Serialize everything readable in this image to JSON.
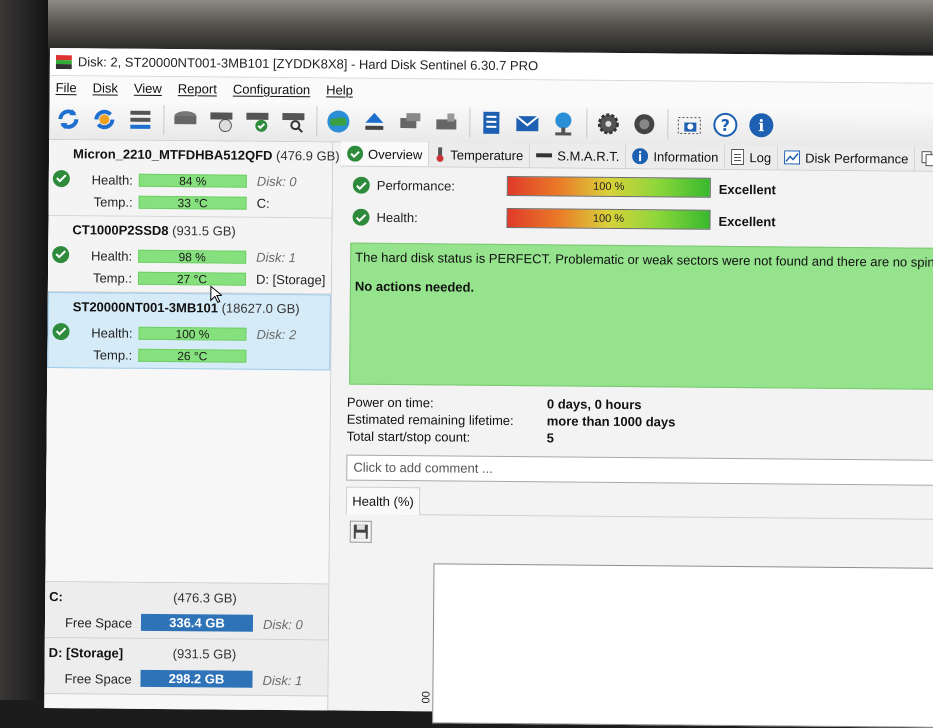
{
  "window": {
    "title": "Disk: 2, ST20000NT001-3MB101 [ZYDDK8X8]  -  Hard Disk Sentinel 6.30.7 PRO"
  },
  "menu": [
    "File",
    "Disk",
    "View",
    "Report",
    "Configuration",
    "Help"
  ],
  "toolbar": {
    "icons": [
      "refresh-icon",
      "refresh-settings-icon",
      "disk-list-icon",
      "disk-icon",
      "disk-schedule-icon",
      "disk-check-icon",
      "disk-search-icon",
      "globe-icon",
      "eject-icon",
      "network-disk-icon",
      "disk-lock-icon",
      "notes-icon",
      "mail-icon",
      "network-icon",
      "gear-icon",
      "speaker-icon",
      "camera-icon",
      "help-icon",
      "info-icon"
    ]
  },
  "disks": [
    {
      "model": "Micron_2210_MTFDHBA512QFD",
      "size": "(476.9 GB)",
      "health_label": "Health:",
      "health": "84 %",
      "temp_label": "Temp.:",
      "temp": "33 °C",
      "disk_ref": "Disk: 0",
      "drive": "C:"
    },
    {
      "model": "CT1000P2SSD8",
      "size": "(931.5 GB)",
      "health_label": "Health:",
      "health": "98 %",
      "temp_label": "Temp.:",
      "temp": "27 °C",
      "disk_ref": "Disk: 1",
      "drive": "D: [Storage]"
    },
    {
      "model": "ST20000NT001-3MB101",
      "size": "(18627.0 GB)",
      "health_label": "Health:",
      "health": "100 %",
      "temp_label": "Temp.:",
      "temp": "26 °C",
      "disk_ref": "Disk: 2",
      "drive": ""
    }
  ],
  "volumes": [
    {
      "name": "C:",
      "size": "(476.3 GB)",
      "free_label": "Free Space",
      "free": "336.4 GB",
      "disk_ref": "Disk: 0"
    },
    {
      "name": "D: [Storage]",
      "size": "(931.5 GB)",
      "free_label": "Free Space",
      "free": "298.2 GB",
      "disk_ref": "Disk: 1"
    }
  ],
  "tabs": [
    "Overview",
    "Temperature",
    "S.M.A.R.T.",
    "Information",
    "Log",
    "Disk Performance"
  ],
  "overview": {
    "performance_label": "Performance:",
    "performance_value": "100 %",
    "performance_text": "Excellent",
    "health_label": "Health:",
    "health_value": "100 %",
    "health_text": "Excellent",
    "status_line1": "The hard disk status is PERFECT. Problematic or weak sectors were not found and there are no spin u",
    "status_line2": "No actions needed.",
    "power_on_label": "Power on time:",
    "power_on_value": "0 days, 0 hours",
    "lifetime_label": "Estimated remaining lifetime:",
    "lifetime_value": "more than 1000 days",
    "startstop_label": "Total start/stop count:",
    "startstop_value": "5",
    "comment_placeholder": "Click to add comment ...",
    "health_tab": "Health (%)",
    "graph_tick": "00"
  },
  "colors": {
    "ok_green": "#2e8b3c",
    "bar_green": "#86e07e",
    "status_green": "#95e38c",
    "free_blue": "#2e73b8",
    "selected": "#d6ebf8"
  }
}
